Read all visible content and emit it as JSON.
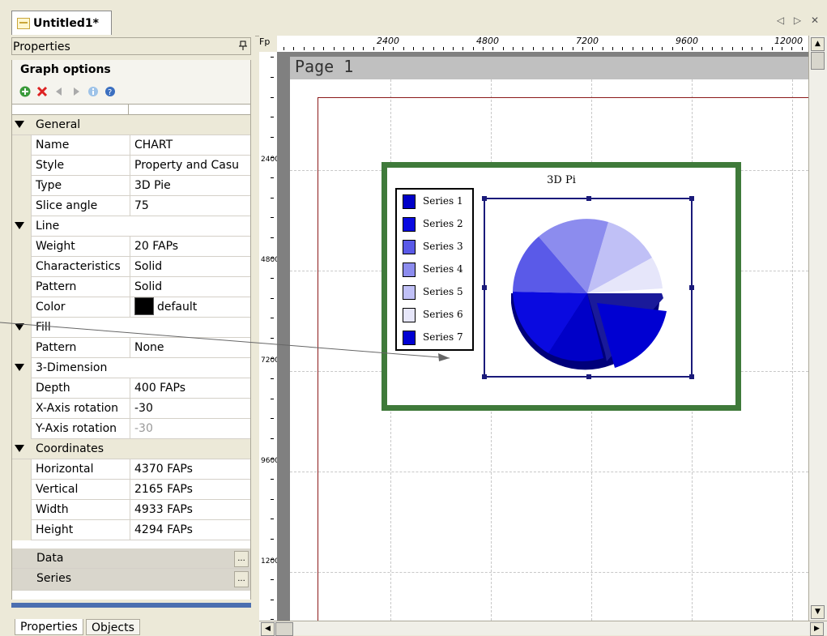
{
  "doc_tab": {
    "title": "Untitled1*",
    "controls": "◁ ▷ ✕"
  },
  "properties_panel": {
    "title": "Properties",
    "pin": "ᵖ",
    "header": "Graph options",
    "categories": {
      "general": "General",
      "line": "Line",
      "fill": "Fill",
      "three_d": "3-Dimension",
      "coordinates": "Coordinates"
    },
    "props": {
      "name": {
        "key": "Name",
        "value": "CHART"
      },
      "style": {
        "key": "Style",
        "value": "Property and Casu"
      },
      "type": {
        "key": "Type",
        "value": "3D Pie"
      },
      "slice_angle": {
        "key": "Slice angle",
        "value": "75"
      },
      "weight": {
        "key": "Weight",
        "value": "20 FAPs"
      },
      "characteristics": {
        "key": "Characteristics",
        "value": "Solid"
      },
      "line_pattern": {
        "key": "Pattern",
        "value": "Solid"
      },
      "color": {
        "key": "Color",
        "value": "default"
      },
      "fill_pattern": {
        "key": "Pattern",
        "value": "None"
      },
      "depth": {
        "key": "Depth",
        "value": "400 FAPs"
      },
      "x_rot": {
        "key": "X-Axis rotation",
        "value": "-30"
      },
      "y_rot": {
        "key": "Y-Axis rotation",
        "value": "-30"
      },
      "horizontal": {
        "key": "Horizontal",
        "value": "4370 FAPs"
      },
      "vertical": {
        "key": "Vertical",
        "value": "2165 FAPs"
      },
      "width": {
        "key": "Width",
        "value": "4933 FAPs"
      },
      "height": {
        "key": "Height",
        "value": "4294 FAPs"
      }
    },
    "data_label": "Data",
    "series_label": "Series",
    "ellipsis": "...",
    "tabs": {
      "properties": "Properties",
      "objects": "Objects"
    }
  },
  "ruler": {
    "corner": "Fp",
    "h_labels": [
      "2400",
      "4800",
      "7200",
      "9600",
      "12000"
    ],
    "v_labels": [
      "2400",
      "4800",
      "7200",
      "9600",
      "1200-"
    ]
  },
  "page": {
    "label": "Page 1"
  },
  "chart": {
    "title": "3D Pi",
    "legend": [
      "Series 1",
      "Series 2",
      "Series 3",
      "Series 4",
      "Series 5",
      "Series 6",
      "Series 7"
    ]
  },
  "colors": {
    "frame": "#3f7a3a",
    "margin": "#8b1a1a",
    "series": [
      "#0000c8",
      "#0a0ae0",
      "#5a5ae8",
      "#8c8cee",
      "#c0c0f6",
      "#e6e6fa",
      "#0000d2"
    ]
  }
}
